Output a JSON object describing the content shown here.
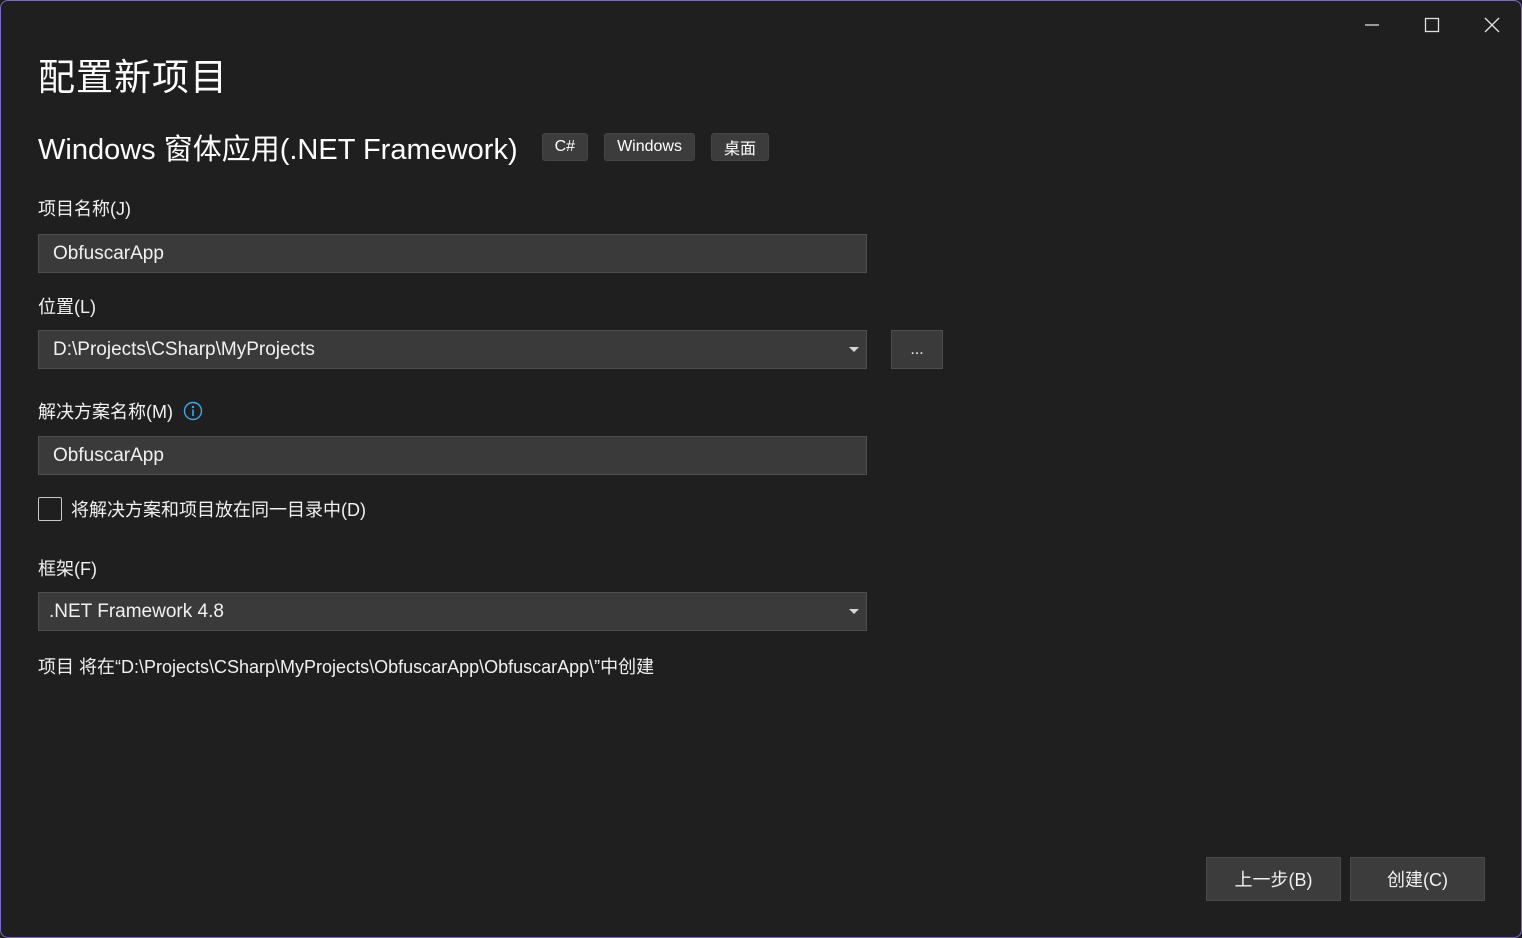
{
  "window": {
    "title": "配置新项目",
    "controls": {
      "minimize_icon": "minimize-icon",
      "maximize_icon": "maximize-icon",
      "close_icon": "close-icon"
    }
  },
  "template": {
    "name": "Windows 窗体应用(.NET Framework)",
    "tags": [
      "C#",
      "Windows",
      "桌面"
    ]
  },
  "form": {
    "project_name": {
      "label": "项目名称(J)",
      "value": "ObfuscarApp"
    },
    "location": {
      "label": "位置(L)",
      "value": "D:\\Projects\\CSharp\\MyProjects",
      "browse_label": "..."
    },
    "solution_name": {
      "label": "解决方案名称(M)",
      "value": "ObfuscarApp",
      "info_icon": "info-icon"
    },
    "same_directory": {
      "label": "将解决方案和项目放在同一目录中(D)",
      "checked": false
    },
    "framework": {
      "label": "框架(F)",
      "value": ".NET Framework 4.8"
    },
    "path_note": "项目 将在“D:\\Projects\\CSharp\\MyProjects\\ObfuscarApp\\ObfuscarApp\\”中创建"
  },
  "buttons": {
    "back": "上一步(B)",
    "create": "创建(C)"
  },
  "colors": {
    "background": "#1f1f1f",
    "window_border": "#7b68c9",
    "field_background": "#3a3a3a",
    "info_accent": "#3ea8ec"
  }
}
